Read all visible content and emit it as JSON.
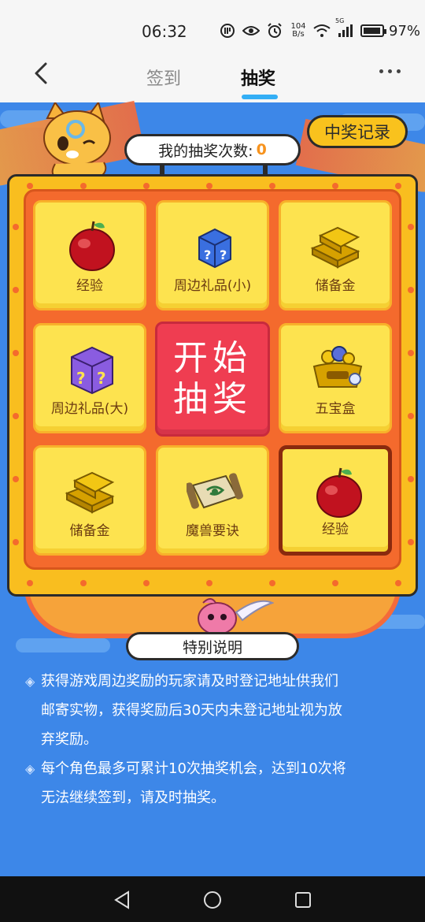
{
  "status_bar": {
    "time": "06:32",
    "net_speed_value": "104",
    "net_speed_unit": "B/s",
    "network": "5G",
    "battery": "97%"
  },
  "nav": {
    "tabs": [
      {
        "label": "签到",
        "active": false
      },
      {
        "label": "抽奖",
        "active": true
      }
    ]
  },
  "header": {
    "record_button": "中奖记录",
    "count_label": "我的抽奖次数:",
    "count_value": "0"
  },
  "board": {
    "start_label_line1": "开始",
    "start_label_line2": "抽奖",
    "prizes": [
      {
        "label": "经验",
        "icon": "apple-icon"
      },
      {
        "label": "周边礼品(小)",
        "icon": "small-mystery-box-icon"
      },
      {
        "label": "储备金",
        "icon": "gold-bars-icon"
      },
      {
        "label": "周边礼品(大)",
        "icon": "large-mystery-box-icon"
      },
      {
        "label": "五宝盒",
        "icon": "treasure-chest-icon"
      },
      {
        "label": "储备金",
        "icon": "gold-bars-icon"
      },
      {
        "label": "魔兽要诀",
        "icon": "scroll-icon"
      },
      {
        "label": "经验",
        "icon": "apple-icon"
      }
    ]
  },
  "notes": {
    "title": "特别说明",
    "items": [
      {
        "lines": [
          "获得游戏周边奖励的玩家请及时登记地址供我们",
          "邮寄实物，获得奖励后30天内未登记地址视为放",
          "弃奖励。"
        ]
      },
      {
        "lines": [
          "每个角色最多可累计10次抽奖机会，达到10次将",
          "无法继续签到，请及时抽奖。"
        ]
      }
    ]
  },
  "colors": {
    "background": "#3d87e8",
    "board": "#f9be1f",
    "inner": "#f46a2d",
    "cell": "#fde34f",
    "start": "#ef3d51",
    "tab_underline": "#33aef5",
    "count_value": "#f7931e"
  }
}
